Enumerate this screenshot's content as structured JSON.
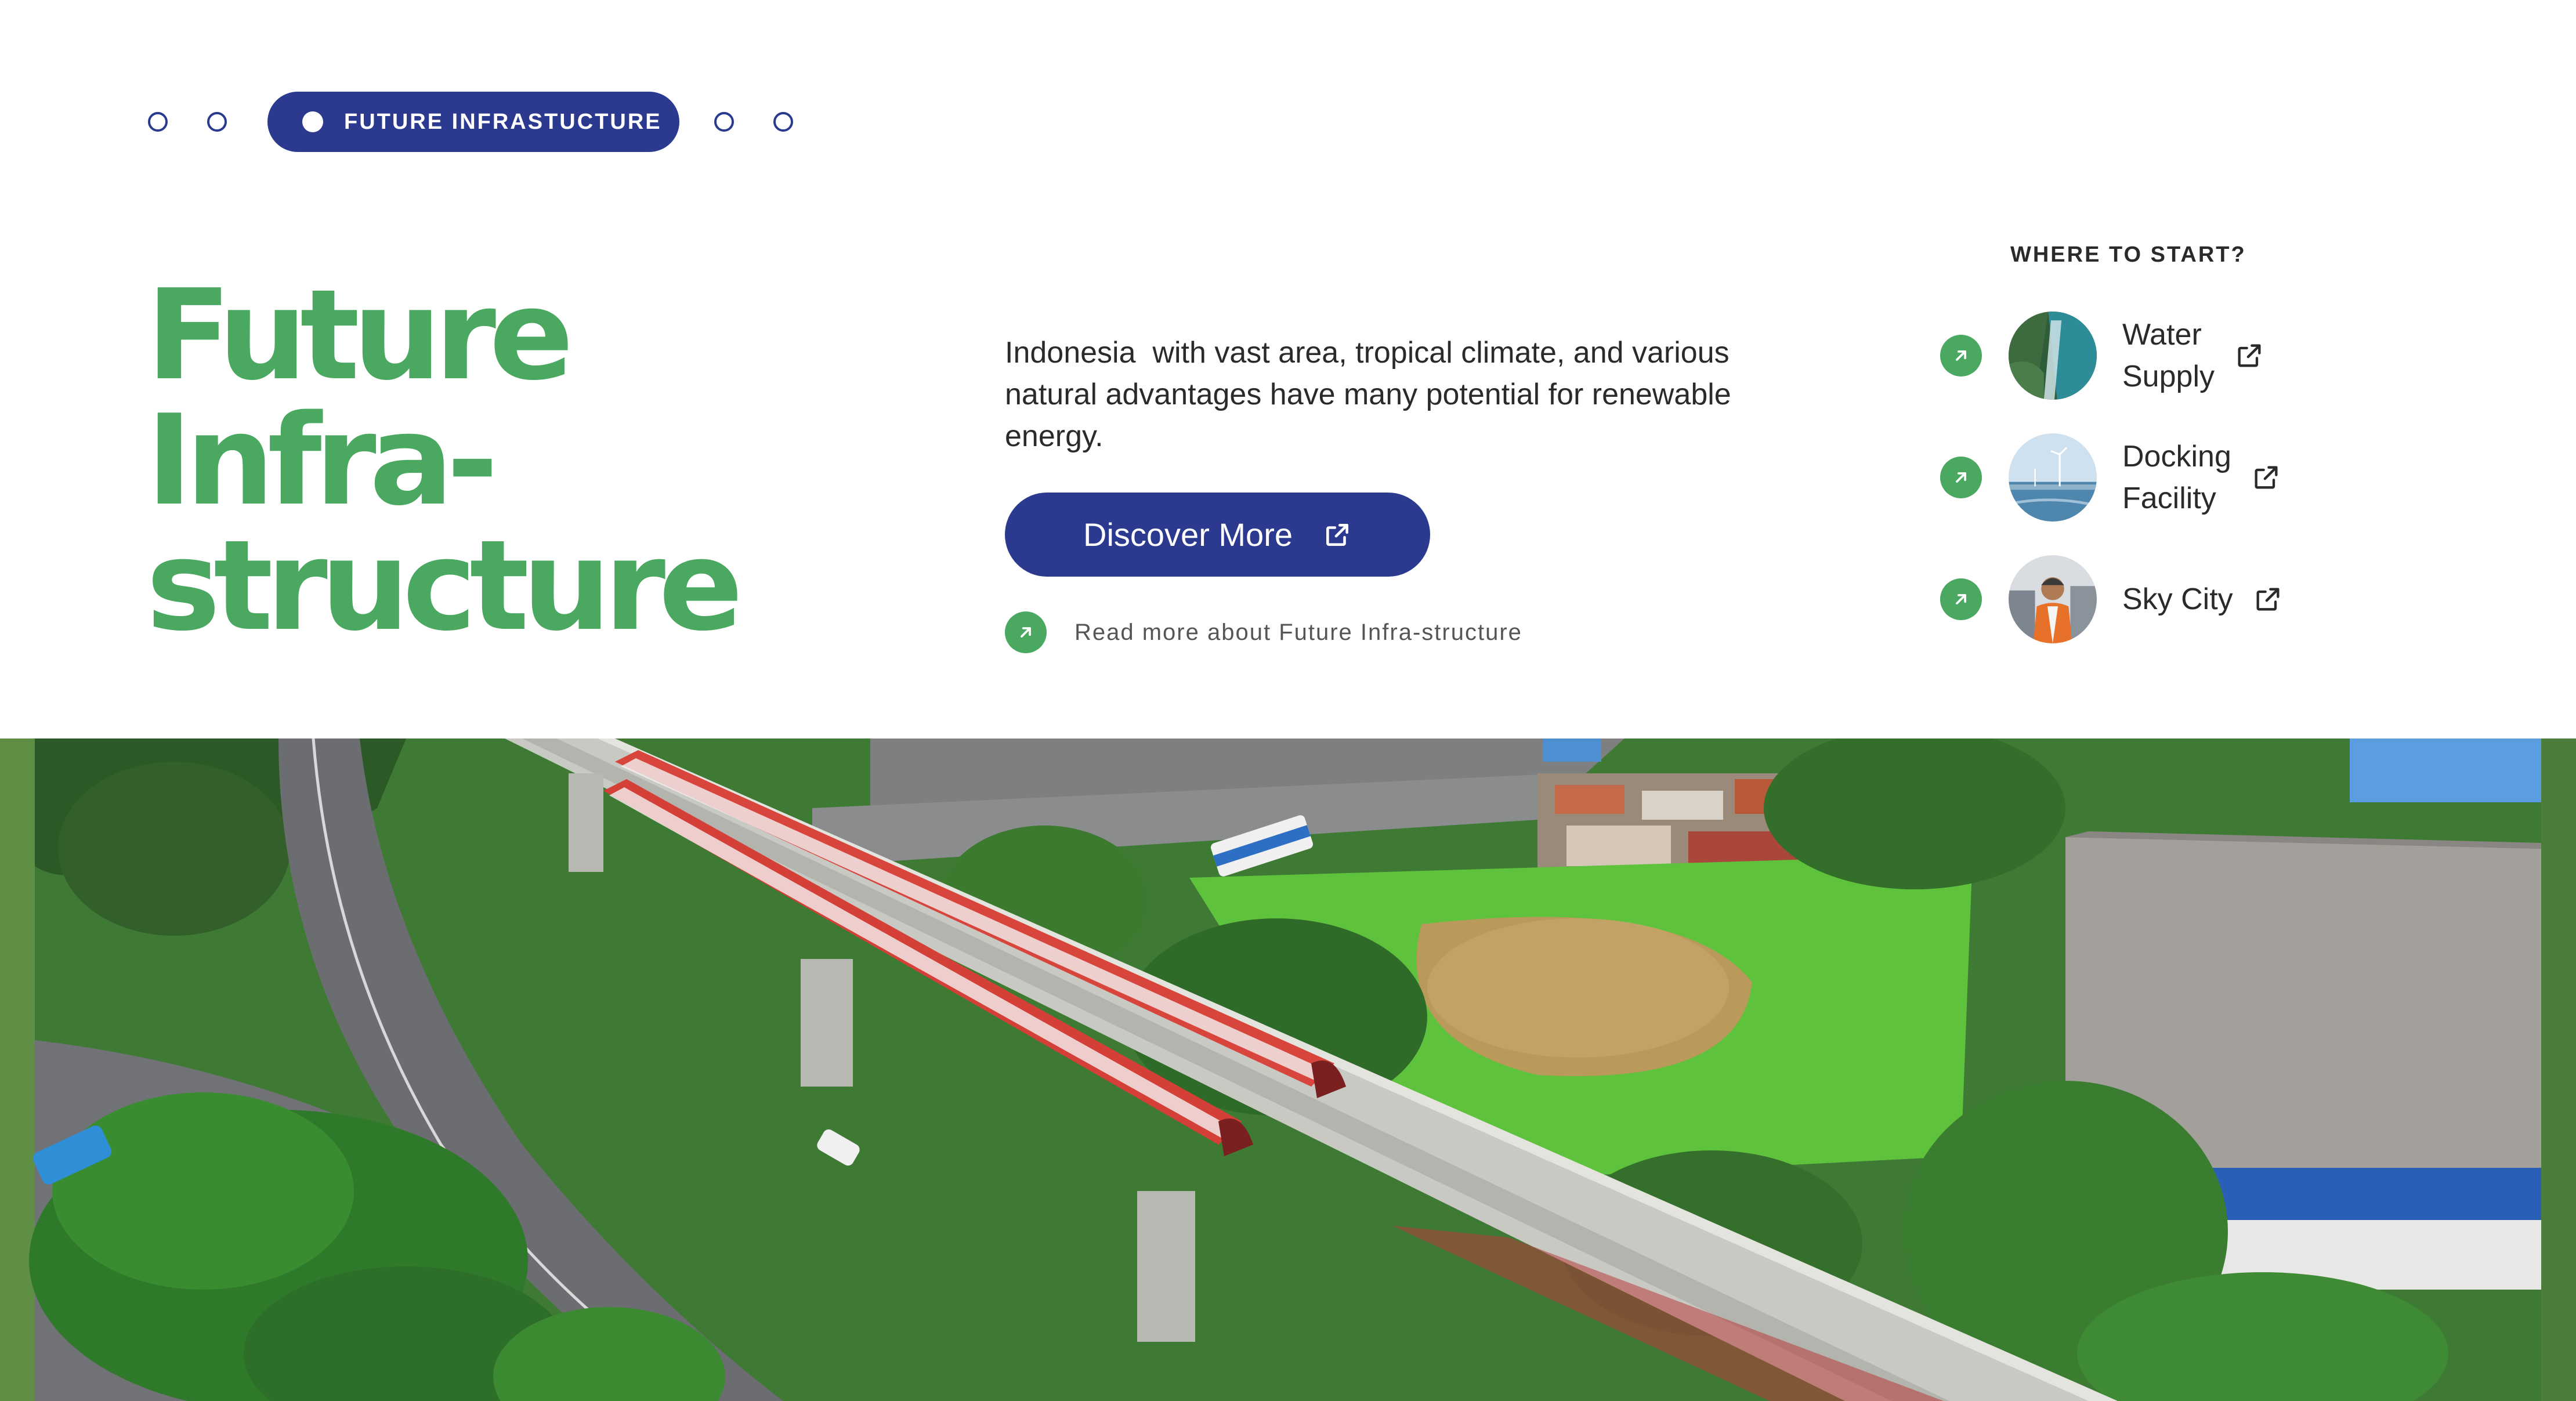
{
  "pager": {
    "active_label": "FUTURE INFRASTUCTURE",
    "dot_count_left": 2,
    "dot_count_right": 2
  },
  "hero": {
    "title_lines": [
      "Future",
      "Infra-",
      "structure"
    ]
  },
  "intro": {
    "text": "Indonesia  with vast area, tropical climate, and various natural advantages have many potential for renewable energy.",
    "discover_label": "Discover More",
    "read_more_label": "Read more about Future Infra-structure"
  },
  "where_to_start": {
    "title": "WHERE TO START?",
    "items": [
      {
        "label": "Water\nSupply",
        "icon": "external-link-icon"
      },
      {
        "label": "Docking\nFacility",
        "icon": "external-link-icon"
      },
      {
        "label": "Sky City",
        "icon": "external-link-icon"
      }
    ]
  },
  "colors": {
    "brand_blue": "#2b3a8f",
    "brand_green": "#4aa860",
    "background": "#ffffff"
  }
}
